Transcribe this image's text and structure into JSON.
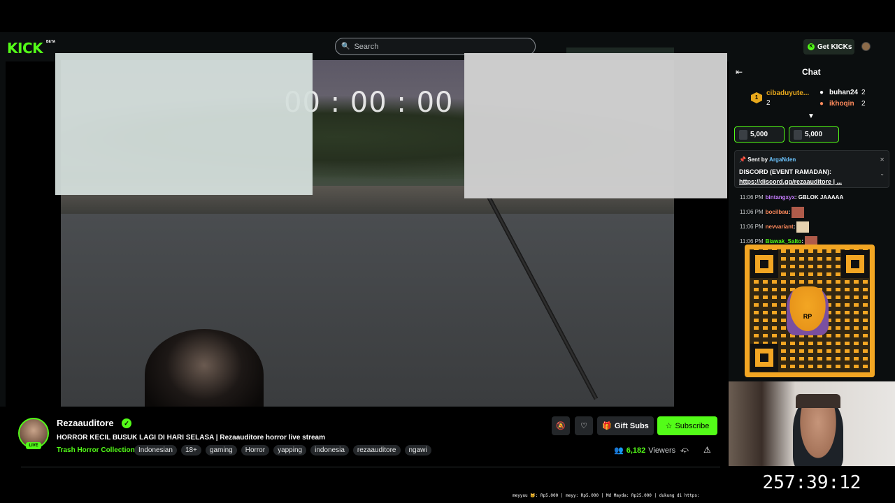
{
  "header": {
    "logo": "KICK",
    "logo_badge": "BETA",
    "search_placeholder": "Search",
    "get_kicks_label": "Get KICKs"
  },
  "player": {
    "timer": "00 : 00 : 00"
  },
  "channel": {
    "name": "Rezaauditore",
    "live_label": "LIVE",
    "title": "HORROR KECIL BUSUK LAGI DI HARI SELASA | Rezaauditore horror live stream",
    "category": "Trash Horror Collection",
    "tags": [
      "Indonesian",
      "18+",
      "gaming",
      "Horror",
      "yapping",
      "indonesia",
      "rezaauditore",
      "ngawi"
    ],
    "gift_subs_label": "Gift Subs",
    "subscribe_label": "Subscribe",
    "viewers_count": "6,182",
    "viewers_label": "Viewers"
  },
  "chat": {
    "title": "Chat",
    "leaderboard": [
      {
        "rank": "1",
        "name": "cibaduyute...",
        "count": "2"
      },
      {
        "name": "buhan24",
        "count": "2"
      },
      {
        "name": "ikhoqin",
        "count": "2"
      }
    ],
    "kick_pills": [
      "5,000",
      "5,000"
    ],
    "pinned": {
      "sent_by_label": "Sent by",
      "sent_by_user": "ArgaNden",
      "heading": "DISCORD (EVENT RAMADAN):",
      "link": "https://discord.gg/rezaauditore | ..."
    },
    "messages": [
      {
        "time": "11:06 PM",
        "user": "bintangxyx",
        "text": ": GBLOK JAAAAA",
        "color": "#c77dff"
      },
      {
        "time": "11:06 PM",
        "user": "bocilbau",
        "text": ":",
        "color": "#ff8a5c"
      },
      {
        "time": "11:06 PM",
        "user": "nevvariant",
        "text": ":",
        "color": "#ff8a5c"
      },
      {
        "time": "11:06 PM",
        "user": "Biawak_Salto",
        "text": ":",
        "color": "#53fc18"
      }
    ]
  },
  "qr": {
    "mascot_label": "RP"
  },
  "clock": "257:39:12",
  "ticker": "meyyuu 🐱: Rp5.000 | meyy: Rp5.000 | Md Mayda: Rp25.000 | dukung di https:"
}
